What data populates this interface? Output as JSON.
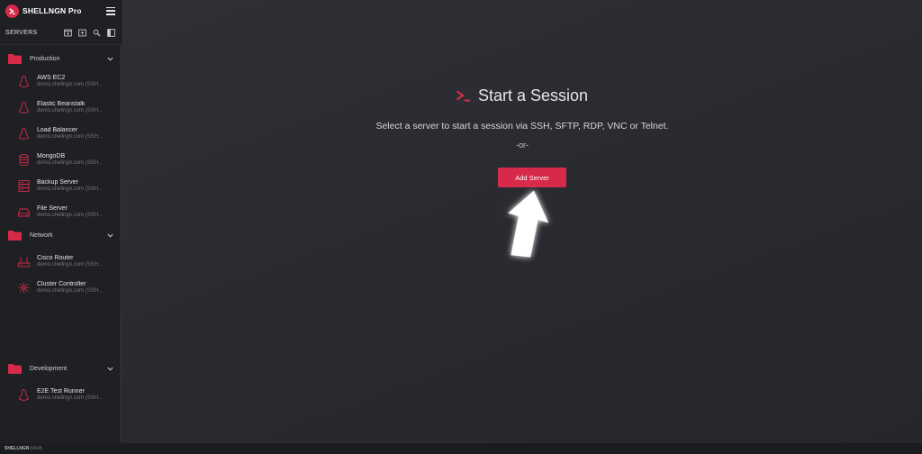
{
  "app": {
    "brand_name": "SHELLNGN",
    "brand_edition": "Pro"
  },
  "sidebar": {
    "title": "SERVERS",
    "groups": [
      {
        "label": "Production",
        "items": [
          {
            "name": "AWS EC2",
            "host": "demo.shellngn.com (SSH...",
            "icon": "linux-icon"
          },
          {
            "name": "Elastic Beanstalk",
            "host": "demo.shellngn.com (SSH...",
            "icon": "linux-icon"
          },
          {
            "name": "Load Balancer",
            "host": "demo.shellngn.com (SSH...",
            "icon": "linux-icon"
          },
          {
            "name": "MongoDB",
            "host": "demo.shellngn.com (SSH...",
            "icon": "database-icon"
          },
          {
            "name": "Backup Server",
            "host": "demo.shellngn.com (SSH...",
            "icon": "server-rack-icon"
          },
          {
            "name": "File Server",
            "host": "demo.shellngn.com (SSH...",
            "icon": "hard-drive-icon"
          }
        ]
      },
      {
        "label": "Network",
        "items": [
          {
            "name": "Cisco Router",
            "host": "demo.shellngn.com (SSH...",
            "icon": "router-icon"
          },
          {
            "name": "Cluster Controller",
            "host": "demo.shellngn.com (SSH...",
            "icon": "cluster-icon"
          }
        ]
      },
      {
        "label": "Development",
        "items": [
          {
            "name": "E2E Test Runner",
            "host": "demo.shellngn.com (SSH...",
            "icon": "linux-icon"
          }
        ]
      }
    ]
  },
  "main": {
    "title": "Start a Session",
    "subtitle": "Select a server to start a session via SSH, SFTP, RDP, VNC or Telnet.",
    "or_text": "-or-",
    "add_button_label": "Add Server"
  },
  "footer": {
    "brand": "SHELLNGN",
    "version": "(v9.0)"
  },
  "colors": {
    "accent": "#d72a4a",
    "sidebar_bg": "#1f2024",
    "main_bg": "#2b2c31"
  }
}
